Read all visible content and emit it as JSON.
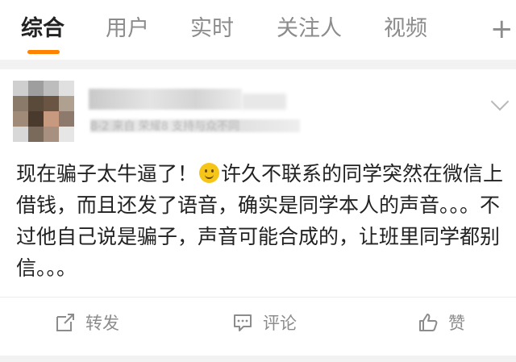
{
  "tabs": [
    {
      "label": "综合",
      "active": true
    },
    {
      "label": "用户"
    },
    {
      "label": "实时"
    },
    {
      "label": "关注人"
    },
    {
      "label": "视频"
    }
  ],
  "add_tab_icon": "plus-icon",
  "accent_color": "#ff8200",
  "post": {
    "meta": "8-2 来自 荣耀8 支持与众不同",
    "text_before_emoji": "现在骗子太牛逼了！",
    "text_after_emoji": "许久不联系的同学突然在微信上借钱，而且还发了语音，确实是同学本人的声音。。。不过他自己说是骗子，声音可能合成的，让班里同学都别信。。。",
    "emoji": "smile-emoji",
    "actions": {
      "repost_label": "转发",
      "comment_label": "评论",
      "like_label": "赞"
    }
  }
}
